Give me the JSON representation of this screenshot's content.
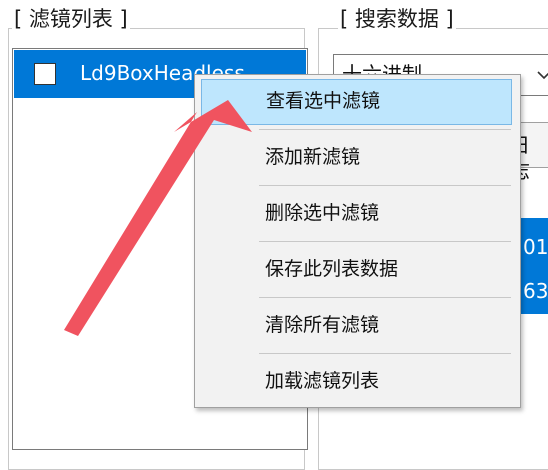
{
  "filter_group": {
    "title": "[ 滤镜列表 ]",
    "items": [
      {
        "label": "Ld9BoxHeadless",
        "checked": false,
        "selected": true
      }
    ]
  },
  "search_group": {
    "title": "[ 搜索数据 ]",
    "mode_select": {
      "value": "十六进制"
    },
    "tab_fragment": "日志",
    "data_fragments": [
      "01",
      "63"
    ]
  },
  "context_menu": {
    "items": [
      {
        "label": "查看选中滤镜",
        "highlighted": true
      },
      {
        "label": "添加新滤镜"
      },
      {
        "label": "删除选中滤镜"
      },
      {
        "label": "保存此列表数据"
      },
      {
        "label": "清除所有滤镜"
      },
      {
        "label": "加载滤镜列表"
      }
    ]
  },
  "colors": {
    "selection": "#0078d7",
    "menu_highlight": "#bee6fd",
    "annotation_arrow": "#f0535f"
  },
  "icons": {
    "combo": "chevron-down-icon",
    "annotation": "arrow-annotation-icon"
  }
}
